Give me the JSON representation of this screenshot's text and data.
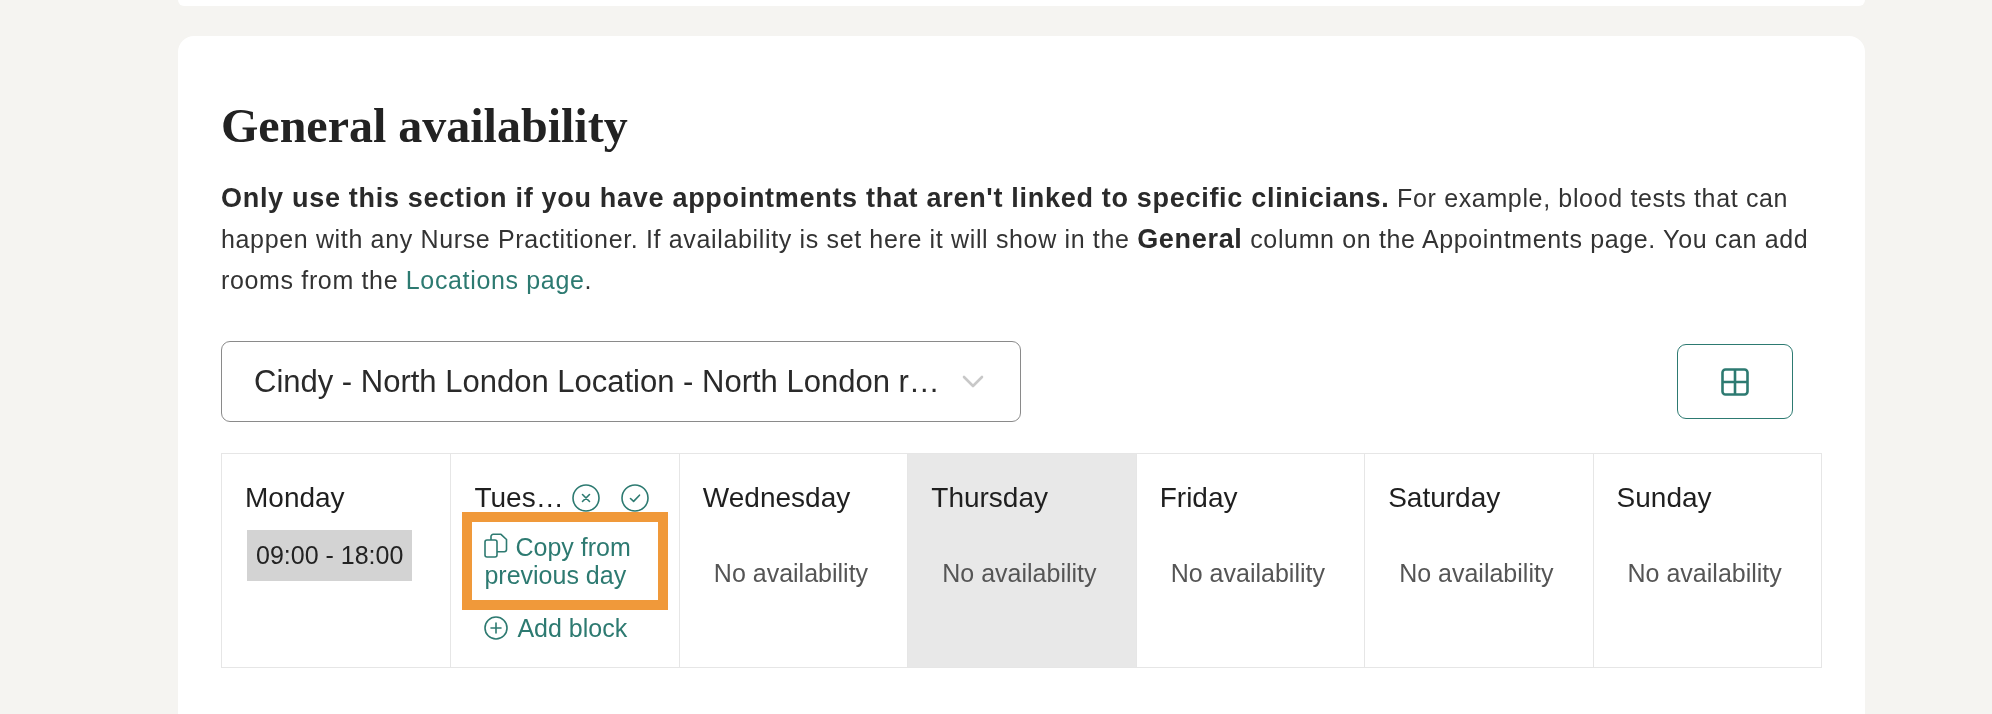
{
  "section": {
    "title": "General availability",
    "description": "**Only use this section if you have appointments that aren't linked to specific clinicians.** For example, blood tests that can happen with any Nurse Practitioner. If availability is set here it will show in the **General** column on the Appointments page. You can add rooms from the",
    "link": "Locations page",
    "description_end": "."
  },
  "location_select": {
    "value": "Cindy - North London Location - North London r…"
  },
  "days": [
    {
      "name": "Monday",
      "kind": "blocks",
      "selected": false,
      "blocks": [
        "09:00 - 18:00"
      ]
    },
    {
      "name": "Tues…",
      "kind": "editing",
      "selected": false,
      "copy": {
        "label": "Copy from previous day",
        "highlighted": true
      },
      "add_label": "Add block"
    },
    {
      "name": "Wednesday",
      "kind": "empty",
      "selected": false,
      "empty_label": "No availability"
    },
    {
      "name": "Thursday",
      "kind": "empty",
      "selected": true,
      "empty_label": "No availability"
    },
    {
      "name": "Friday",
      "kind": "empty",
      "selected": false,
      "empty_label": "No availability"
    },
    {
      "name": "Saturday",
      "kind": "empty",
      "selected": false,
      "empty_label": "No availability"
    },
    {
      "name": "Sunday",
      "kind": "empty",
      "selected": false,
      "empty_label": "No availability"
    }
  ]
}
